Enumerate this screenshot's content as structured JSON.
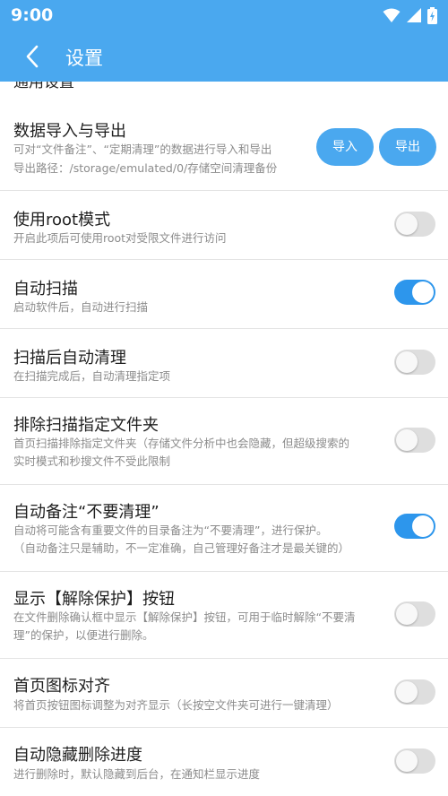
{
  "status_bar": {
    "time": "9:00"
  },
  "header": {
    "title": "设置"
  },
  "partial_section_label": "通用设置",
  "colors": {
    "accent": "#4aa8ef",
    "toggle_on": "#2d96ec",
    "toggle_off": "#dedede"
  },
  "import_export": {
    "title": "数据导入与导出",
    "desc1": "可对“文件备注”、“定期清理”的数据进行导入和导出",
    "desc2": "导出路径：/storage/emulated/0/存储空间清理备份",
    "import_label": "导入",
    "export_label": "导出"
  },
  "settings": [
    {
      "title": "使用root模式",
      "desc": [
        "开启此项后可使用root对受限文件进行访问"
      ],
      "on": false
    },
    {
      "title": "自动扫描",
      "desc": [
        "启动软件后，自动进行扫描"
      ],
      "on": true
    },
    {
      "title": "扫描后自动清理",
      "desc": [
        "在扫描完成后，自动清理指定项"
      ],
      "on": false
    },
    {
      "title": "排除扫描指定文件夹",
      "desc": [
        "首页扫描排除指定文件夹（存储文件分析中也会隐藏，但超级搜索的",
        "实时模式和秒搜文件不受此限制"
      ],
      "on": false
    },
    {
      "title": "自动备注“不要清理”",
      "desc": [
        "自动将可能含有重要文件的目录备注为“不要清理”，进行保护。",
        "（自动备注只是辅助，不一定准确，自己管理好备注才是最关键的）"
      ],
      "on": true
    },
    {
      "title": "显示【解除保护】按钮",
      "desc": [
        "在文件删除确认框中显示【解除保护】按钮，可用于临时解除“不要清",
        "理”的保护，以便进行删除。"
      ],
      "on": false
    },
    {
      "title": "首页图标对齐",
      "desc": [
        "将首页按钮图标调整为对齐显示（长按空文件夹可进行一键清理）"
      ],
      "on": false
    },
    {
      "title": "自动隐藏删除进度",
      "desc": [
        "进行删除时，默认隐藏到后台，在通知栏显示进度"
      ],
      "on": false
    }
  ]
}
